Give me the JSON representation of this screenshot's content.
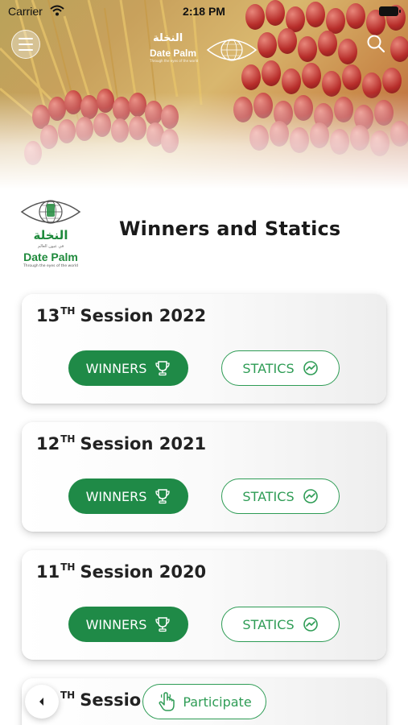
{
  "status_bar": {
    "carrier": "Carrier",
    "time": "2:18 PM"
  },
  "header": {
    "logo_arabic": "النخلة",
    "logo_brand": "Date Palm",
    "logo_tagline": "Through the eyes of the world"
  },
  "brand": {
    "arabic_name": "النخلة",
    "arabic_tagline": "في عيون العالم",
    "english_name": "Date Palm",
    "english_tagline": "Through the eyes of the world"
  },
  "page": {
    "title": "Winners and Statics"
  },
  "sessions": [
    {
      "number": "13",
      "ordinal_suffix": "TH",
      "label": "Session 2022",
      "winners_label": "WINNERS",
      "statics_label": "STATICS"
    },
    {
      "number": "12",
      "ordinal_suffix": "TH",
      "label": "Session 2021",
      "winners_label": "WINNERS",
      "statics_label": "STATICS"
    },
    {
      "number": "11",
      "ordinal_suffix": "TH",
      "label": "Session 2020",
      "winners_label": "WINNERS",
      "statics_label": "STATICS"
    },
    {
      "number": "",
      "ordinal_suffix": "TH",
      "label": "Sessio"
    }
  ],
  "bottom": {
    "participate_label": "Participate"
  },
  "colors": {
    "primary_green": "#1f8a47",
    "outline_green": "#2e9c55",
    "date_red": "#b72d2a"
  },
  "icons": {
    "menu": "hamburger-icon",
    "search": "search-icon",
    "winners": "trophy-icon",
    "statics": "trend-chart-icon",
    "back": "chevron-left-icon",
    "participate": "hand-pointer-icon"
  }
}
